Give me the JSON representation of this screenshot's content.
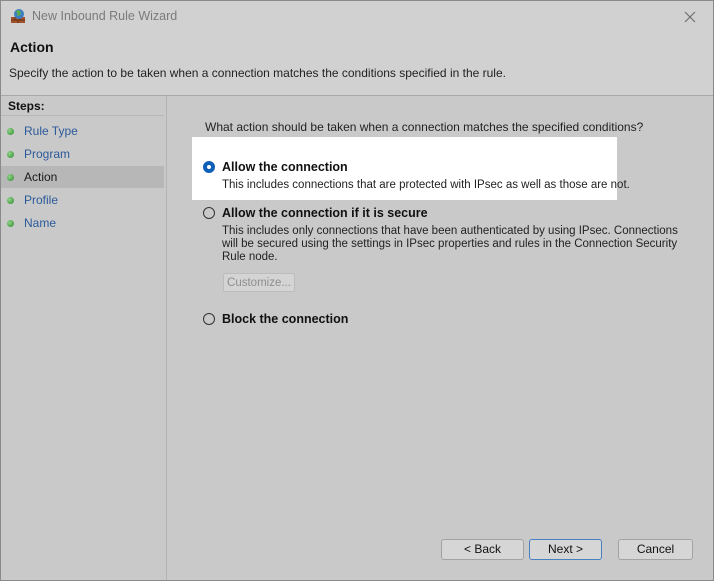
{
  "window": {
    "title": "New Inbound Rule Wizard"
  },
  "header": {
    "title": "Action",
    "description": "Specify the action to be taken when a connection matches the conditions specified in the rule."
  },
  "sidebar": {
    "steps_label": "Steps:",
    "items": [
      {
        "label": "Rule Type"
      },
      {
        "label": "Program"
      },
      {
        "label": "Action"
      },
      {
        "label": "Profile"
      },
      {
        "label": "Name"
      }
    ],
    "active_item": "Action"
  },
  "main": {
    "question": "What action should be taken when a connection matches the specified conditions?",
    "options": [
      {
        "label": "Allow the connection",
        "description": "This includes connections that are protected with IPsec as well as those are not.",
        "selected": true
      },
      {
        "label": "Allow the connection if it is secure",
        "description_lines": [
          "This includes only connections that have been authenticated by using IPsec.  Connections",
          "will be secured using the settings in IPsec properties and rules in the Connection Security",
          "Rule node."
        ],
        "selected": false
      },
      {
        "label": "Block the connection",
        "selected": false
      }
    ],
    "customize_label": "Customize..."
  },
  "footer": {
    "back_label": "< Back",
    "next_label": "Next >",
    "cancel_label": "Cancel"
  },
  "colors": {
    "accent": "#0f5fb8",
    "step_link": "#2b5a9a",
    "step_dot": "#3a9a34"
  },
  "icons": {
    "app": "firewall-globe-icon",
    "close": "close-icon",
    "step": "step-dot-icon"
  }
}
